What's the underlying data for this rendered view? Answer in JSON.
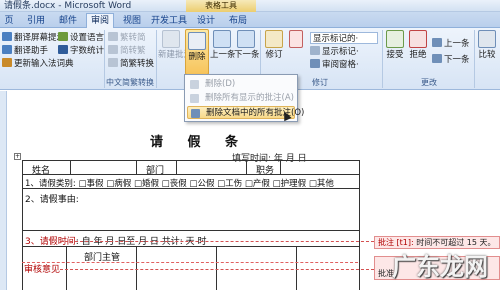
{
  "window": {
    "title": "请假条.docx - Microsoft Word",
    "context_tab": "表格工具"
  },
  "tabs": [
    "页",
    "引用",
    "邮件",
    "审阅",
    "视图",
    "开发工具",
    "设计",
    "布局"
  ],
  "ribbon": {
    "proofing": {
      "items": [
        "翻译屏幕提示·",
        "设置语言",
        "翻译助手",
        "字数统计",
        "更新输入法词典"
      ]
    },
    "chinese_convert": {
      "items": [
        "繁转简",
        "简转繁",
        "简繁转换"
      ],
      "label": "中文简繁转换"
    },
    "comments": {
      "new": "新建批注",
      "delete": "删除",
      "prev": "上一条",
      "next": "下一条"
    },
    "tracking": {
      "track": "修订",
      "show_markup": "显示标记的·",
      "show_markup2": "显示标记·",
      "review_pane": "审阅窗格·",
      "label": "修订"
    },
    "changes": {
      "accept": "接受",
      "reject": "拒绝",
      "prev": "上一条",
      "next": "下一条",
      "label": "更改"
    },
    "compare": {
      "label": "比较"
    }
  },
  "delete_menu": {
    "items": [
      "删除(D)",
      "删除所有显示的批注(A)",
      "删除文档中的所有批注(O)"
    ]
  },
  "document": {
    "title": "请 假 条",
    "fill_date": "填写时间:     年  月  日",
    "row1": {
      "name": "姓名",
      "dept": "部门",
      "post": "职务"
    },
    "row2": "1、请假类别: □事假 □病假 □婚假 □丧假 □公假 □工伤 □产假 □护理假 □其他",
    "row3": "2、请假事由:",
    "row4": {
      "label": "3、请假时间",
      "rest": ": 自    年  月  日至  月  日    共计:  天  时"
    },
    "row5": {
      "label": "审核意见",
      "dept_head": "部门主管"
    }
  },
  "balloons": [
    {
      "tag": "批注 [t1]:",
      "text": "时间不可超过 15 天。"
    },
    {
      "tag": "",
      "text": "批准。"
    }
  ],
  "watermark": "广东龙网",
  "colors": {
    "ribbon": "#dbe6f4",
    "active_tab": "#eef4fc",
    "highlight": "#f8d98a",
    "comment_red": "#b00000",
    "balloon": "#fde7e7"
  }
}
